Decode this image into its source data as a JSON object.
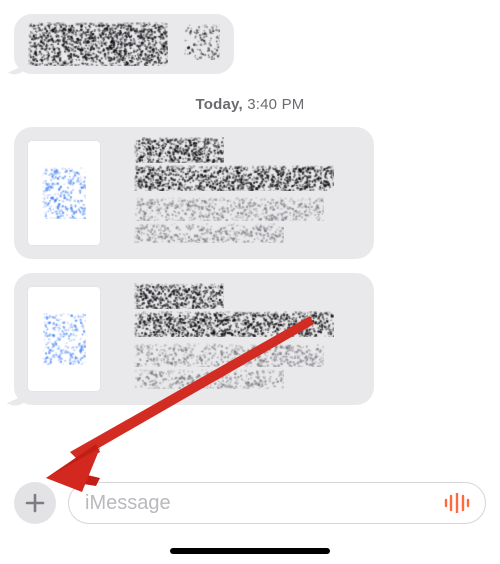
{
  "timestamp": {
    "day": "Today",
    "time": "3:40 PM"
  },
  "input": {
    "placeholder": "iMessage"
  },
  "icons": {
    "plus": "plus-icon",
    "voice": "voice-message-icon"
  },
  "colors": {
    "bubble": "#e9e9eb",
    "placeholder": "#b9b9be",
    "timestamp": "#6b6b70",
    "annotation_arrow": "#d3281f",
    "voice_icon": "#ff6a3d"
  }
}
